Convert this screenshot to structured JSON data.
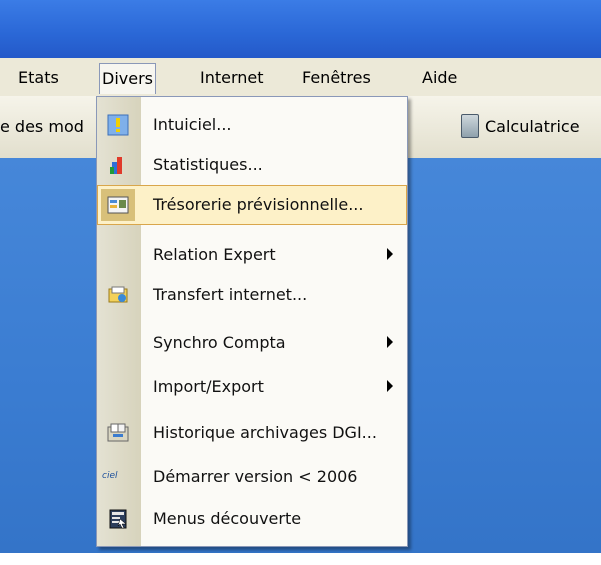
{
  "menubar": {
    "items": [
      {
        "label": "Etats"
      },
      {
        "label": "Divers"
      },
      {
        "label": "Internet"
      },
      {
        "label": "Fenêtres"
      },
      {
        "label": "Aide"
      }
    ]
  },
  "toolbar": {
    "left_text": "e des mod",
    "calculator_label": "Calculatrice"
  },
  "dropdown": {
    "items": [
      {
        "label": "Intuiciel...",
        "icon": "info-icon"
      },
      {
        "label": "Statistiques...",
        "icon": "statistics-icon"
      },
      {
        "label": "Trésorerie prévisionnelle...",
        "icon": "treasury-icon",
        "highlighted": true
      },
      {
        "label": "Relation Expert",
        "submenu": true
      },
      {
        "label": "Transfert internet...",
        "icon": "transfer-icon"
      },
      {
        "label": "Synchro Compta",
        "submenu": true
      },
      {
        "label": "Import/Export",
        "submenu": true
      },
      {
        "label": "Historique archivages DGI...",
        "icon": "archive-icon"
      },
      {
        "label": "Démarrer version < 2006",
        "icon": "ciel-logo-icon",
        "icon_text": "ciel"
      },
      {
        "label": "Menus découverte",
        "icon": "discovery-menu-icon"
      }
    ]
  },
  "colors": {
    "menubar_bg": "#ece9d8",
    "desktop_blue": "#3a7cd1",
    "highlight_bg": "#fdf1c8",
    "highlight_border": "#d9a64b"
  }
}
